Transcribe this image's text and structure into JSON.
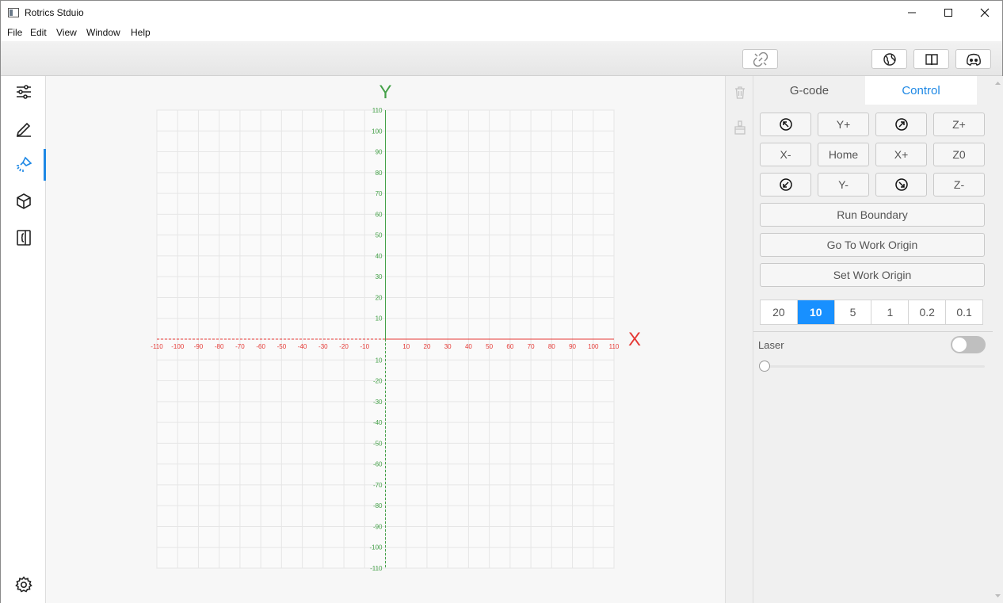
{
  "window": {
    "title": "Rotrics Stduio"
  },
  "menu": [
    "File",
    "Edit",
    "View",
    "Window",
    "Help"
  ],
  "toolbar": {
    "icons": [
      "disconnect-icon",
      "globe-icon",
      "book-icon",
      "discord-icon"
    ]
  },
  "sidebar": {
    "items": [
      "settings-sliders-icon",
      "pen-icon",
      "laser-icon",
      "cube-icon",
      "code-book-icon"
    ],
    "active_index": 2,
    "bottom": "gear-icon"
  },
  "canvas": {
    "x_axis_label": "X",
    "y_axis_label": "Y",
    "x_ticks": [
      "-110",
      "-100",
      "-90",
      "-80",
      "-70",
      "-60",
      "-50",
      "-40",
      "-30",
      "-20",
      "-10",
      "10",
      "20",
      "30",
      "40",
      "50",
      "60",
      "70",
      "80",
      "90",
      "100",
      "110"
    ],
    "y_ticks_pos": [
      "110",
      "100",
      "90",
      "80",
      "70",
      "60",
      "50",
      "40",
      "30",
      "20",
      "10"
    ],
    "y_ticks_neg": [
      "10",
      "-20",
      "-30",
      "-40",
      "-50",
      "-60",
      "-70",
      "-80",
      "-90",
      "-100",
      "-110"
    ],
    "range": [
      -110,
      110
    ],
    "x_color": "#e53935",
    "y_color": "#43a047"
  },
  "mini_tools": [
    "trash-icon",
    "brush-icon"
  ],
  "panel": {
    "tabs": [
      "G-code",
      "Control"
    ],
    "active_tab": "Control",
    "jog": {
      "y_plus": "Y+",
      "z_plus": "Z+",
      "x_minus": "X-",
      "home": "Home",
      "x_plus": "X+",
      "z0": "Z0",
      "y_minus": "Y-",
      "z_minus": "Z-"
    },
    "run_boundary": "Run Boundary",
    "go_to_work_origin": "Go To Work Origin",
    "set_work_origin": "Set Work Origin",
    "steps": [
      "20",
      "10",
      "5",
      "1",
      "0.2",
      "0.1"
    ],
    "selected_step": "10",
    "laser_label": "Laser",
    "laser_on": false,
    "laser_power": 0
  },
  "accent": "#1890ff"
}
